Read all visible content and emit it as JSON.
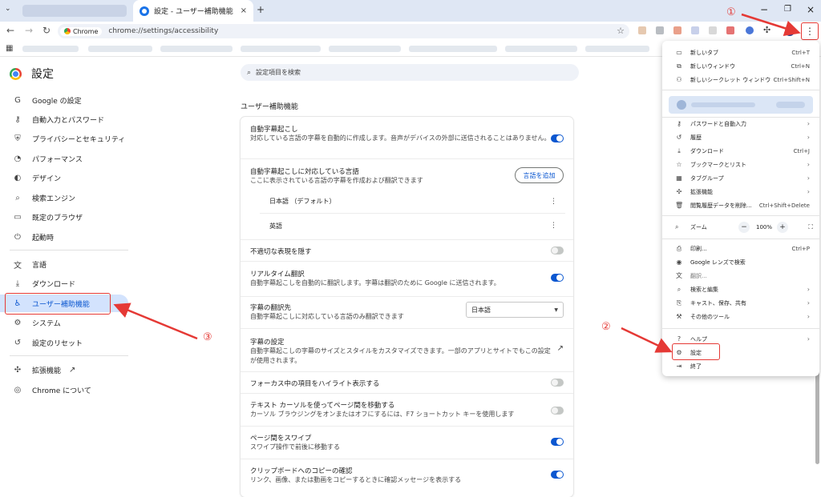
{
  "browser": {
    "tab_title": "設定 - ユーザー補助機能",
    "tab_close": "×",
    "new_tab": "+",
    "url_chip": "Chrome",
    "url": "chrome://settings/accessibility",
    "win_min": "−",
    "win_max": "❐",
    "win_close": "×"
  },
  "sidebar": {
    "title": "設定",
    "items": [
      {
        "label": "Google の設定",
        "icon": "G"
      },
      {
        "label": "自動入力とパスワード",
        "icon": "⚷"
      },
      {
        "label": "プライバシーとセキュリティ",
        "icon": "⛨"
      },
      {
        "label": "パフォーマンス",
        "icon": "◔"
      },
      {
        "label": "デザイン",
        "icon": "◐"
      },
      {
        "label": "検索エンジン",
        "icon": "⌕"
      },
      {
        "label": "既定のブラウザ",
        "icon": "▭"
      },
      {
        "label": "起動時",
        "icon": "⏻"
      },
      {
        "label": "言語",
        "icon": "文"
      },
      {
        "label": "ダウンロード",
        "icon": "⤓"
      },
      {
        "label": "ユーザー補助機能",
        "icon": "♿"
      },
      {
        "label": "システム",
        "icon": "⚙"
      },
      {
        "label": "設定のリセット",
        "icon": "↺"
      },
      {
        "label": "拡張機能",
        "icon": "✣"
      },
      {
        "label": "Chrome について",
        "icon": "◎"
      }
    ],
    "extensions_link_icon": "↗"
  },
  "main": {
    "search_placeholder": "設定項目を検索",
    "section_title": "ユーザー補助機能",
    "rows": {
      "live_caption_title": "自動字幕起こし",
      "live_caption_desc": "対応している言語の字幕を自動的に作成します。音声がデバイスの外部に送信されることはありません。",
      "caption_lang_title": "自動字幕起こしに対応している言語",
      "caption_lang_desc": "ここに表示されている言語の字幕を作成および翻訳できます",
      "add_lang_button": "言語を追加",
      "lang_1": "日本語 （デフォルト）",
      "lang_2": "英語",
      "more": "⋮",
      "hide_profanity": "不適切な表現を隠す",
      "realtime_title": "リアルタイム翻訳",
      "realtime_desc": "自動字幕起こしを自動的に翻訳します。字幕は翻訳のために Google に送信されます。",
      "translate_to_title": "字幕の翻訳先",
      "translate_to_desc": "自動字幕起こしに対応している言語のみ翻訳できます",
      "translate_to_value": "日本語",
      "caption_settings_title": "字幕の設定",
      "caption_settings_desc": "自動字幕起こしの字幕のサイズとスタイルをカスタマイズできます。一部のアプリとサイトでもこの設定が使用されます。",
      "focus_highlight": "フォーカス中の項目をハイライト表示する",
      "caret_title": "テキスト カーソルを使ってページ間を移動する",
      "caret_desc": "カーソル ブラウジングをオンまたはオフにするには、F7 ショートカット キーを使用します",
      "swipe_title": "ページ間をスワイプ",
      "swipe_desc": "スワイプ操作で前後に移動する",
      "clipboard_title": "クリップボードへのコピーの確認",
      "clipboard_desc": "リンク、画像、または動画をコピーするときに確認メッセージを表示する"
    },
    "toggles": {
      "live_caption": true,
      "hide_profanity": false,
      "realtime": true,
      "focus_highlight": false,
      "caret": false,
      "swipe": true,
      "clipboard": true
    }
  },
  "menu": {
    "new_tab": "新しいタブ",
    "new_tab_sc": "Ctrl+T",
    "new_window": "新しいウィンドウ",
    "new_window_sc": "Ctrl+N",
    "incognito": "新しいシークレット ウィンドウ",
    "incognito_sc": "Ctrl+Shift+N",
    "passwords": "パスワードと自動入力",
    "history": "履歴",
    "downloads": "ダウンロード",
    "downloads_sc": "Ctrl+J",
    "bookmarks": "ブックマークとリスト",
    "tab_groups": "タブグループ",
    "extensions": "拡張機能",
    "clear_data": "閲覧履歴データを削除...",
    "clear_data_sc": "Ctrl+Shift+Delete",
    "zoom": "ズーム",
    "zoom_value": "100%",
    "zoom_minus": "−",
    "zoom_plus": "+",
    "print": "印刷...",
    "print_sc": "Ctrl+P",
    "lens": "Google レンズで検索",
    "translate": "翻訳...",
    "find_edit": "検索と編集",
    "cast_save": "キャスト、保存、共有",
    "more_tools": "その他のツール",
    "help": "ヘルプ",
    "settings": "設定",
    "exit": "終了"
  },
  "annotations": {
    "one": "①",
    "two": "②",
    "three": "③"
  },
  "colors": {
    "accent": "#0b57d0",
    "annotation_red": "#e53935",
    "active_bg": "#d3e3fd"
  }
}
